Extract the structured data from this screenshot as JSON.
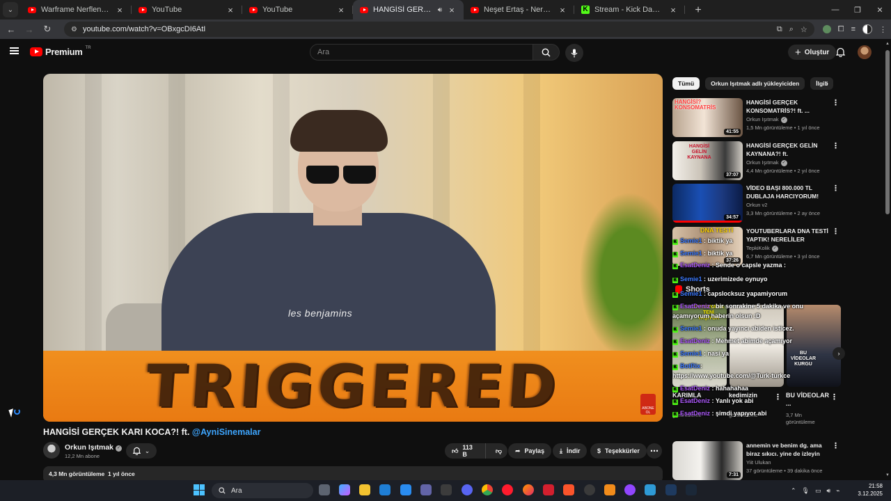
{
  "browser": {
    "tabs": [
      {
        "title": "Warframe Nerflenmeden Ö",
        "favicon": "youtube",
        "active": false
      },
      {
        "title": "YouTube",
        "favicon": "youtube",
        "active": false
      },
      {
        "title": "YouTube",
        "favicon": "youtube",
        "active": false
      },
      {
        "title": "HANGİSİ GERÇEK KARI KOC",
        "favicon": "youtube",
        "active": true,
        "audio": true
      },
      {
        "title": "Neşet Ertaş - Neredesin Sen (Je",
        "favicon": "youtube",
        "active": false
      },
      {
        "title": "Stream - Kick Dashboard",
        "favicon": "kick",
        "active": false
      }
    ],
    "url": "youtube.com/watch?v=OBxgcDI6AtI"
  },
  "header": {
    "logo_text": "Premium",
    "logo_region": "TR",
    "search_placeholder": "Ara",
    "create_label": "Oluştur"
  },
  "video": {
    "overlay_text": "TRIGGERED",
    "shirt_text": "les benjamins",
    "watermark": "ABONE OL",
    "title": "HANGİSİ GERÇEK KARI KOCA?! ft.",
    "title_link": "@AyniSinemalar",
    "channel": "Orkun Işıtmak",
    "subscribers": "12,2 Mn abone",
    "likes": "113 B",
    "share_label": "Paylaş",
    "download_label": "İndir",
    "thanks_label": "Teşekkürler",
    "views": "4,3 Mn görüntüleme",
    "age": "1 yıl önce"
  },
  "chips": [
    "Tümü",
    "Orkun Işıtmak adlı yükleyiciden",
    "İlgili"
  ],
  "recommendations": [
    {
      "title": "HANGİSİ GERÇEK KONSOMATRİS?! ft. ...",
      "channel": "Orkun Işıtmak",
      "verified": true,
      "meta": "1,5 Mn görüntüleme • 1 yıl önce",
      "duration": "41:55",
      "thumb_text": "HANGİSİ? KONSOMATRİS"
    },
    {
      "title": "HANGİSİ GERÇEK GELİN KAYNANA?! ft. @AyniSinemalar",
      "channel": "Orkun Işıtmak",
      "verified": true,
      "meta": "4,4 Mn görüntüleme • 2 yıl önce",
      "duration": "37:07",
      "thumb_text": "HANGİSİ GELİN KAYNANA"
    },
    {
      "title": "VİDEO BAŞI 800.000 TL DUBLAJA HARCIYORUM! Ruhi...",
      "channel": "Orkun v2",
      "verified": false,
      "meta": "3,3 Mn görüntüleme • 2 ay önce",
      "duration": "34:57",
      "thumb_text": ""
    },
    {
      "title": "YOUTUBERLARA DNA TESTİ YAPTIK! NERELİLER ÖĞRENDİK!",
      "channel": "TepkiKolik",
      "verified": true,
      "meta": "6,7 Mn görüntüleme • 3 yıl önce",
      "duration": "37:26",
      "thumb_text": "DNA TESTİ"
    }
  ],
  "shorts": {
    "heading": "Shorts",
    "items": [
      {
        "caption": "KARIMLA",
        "views": "görüntüleme"
      },
      {
        "caption": "kedimizin",
        "views": "görüntüleme"
      },
      {
        "caption": "BU VİDEOLAR ...",
        "views": "3,7 Mn görüntüleme"
      }
    ],
    "thumb_texts": [
      "JAPONYA'YA TENİ YAŞIYOR",
      "BU VİDEOLAR KURGU"
    ]
  },
  "last_rec": {
    "title": "annemin ve benim dg. ama biraz sıkıcı. yine de izleyin",
    "channel": "Yiit Ulukan",
    "meta": "37 görüntüleme • 39 dakika önce",
    "duration": "7:31"
  },
  "chat": [
    {
      "user": "Semie1",
      "msg": "biktik ya",
      "color": "blue"
    },
    {
      "user": "Semie1",
      "msg": "biktik ya",
      "color": "blue"
    },
    {
      "user": "EsatDeniz",
      "msg": "Sende o capsle yazma :",
      "color": "purple"
    },
    {
      "user": "Semie1",
      "msg": "uzerimizede oynuyo",
      "color": "blue"
    },
    {
      "user": "Semie1",
      "msg": "capslocksuz yapamiyorum",
      "color": "blue"
    },
    {
      "user": "EsatDeniz",
      "msg": "bir sonrakine 5 dakika ve onu",
      "color": "purple"
    },
    {
      "user": "",
      "msg": "açamıyorum haberin olsun :D",
      "color": "white"
    },
    {
      "user": "Semie1",
      "msg": "onuda yayıncı abiden isticez.",
      "color": "blue"
    },
    {
      "user": "EsatDeniz",
      "msg": "Mehmet abimde açamıyor",
      "color": "purple"
    },
    {
      "user": "Semie1",
      "msg": "nasi ya",
      "color": "blue"
    },
    {
      "user": "BotRix",
      "msg": "",
      "color": "blue"
    },
    {
      "user": "",
      "msg": "https://www.youtube.com/@Turk-turkce",
      "color": "white"
    },
    {
      "user": "EsatDeniz",
      "msg": "hahahahaa",
      "color": "purple"
    },
    {
      "user": "EsatDeniz",
      "msg": "Yanlı yok abi",
      "color": "purple"
    },
    {
      "user": "EsatDeniz",
      "msg": "şimdi yapıyor abi",
      "color": "purple"
    }
  ],
  "taskbar": {
    "search_label": "Ara",
    "time": "21:58",
    "date": "3.12.2025"
  },
  "colors": {
    "accent": "#ff0000",
    "link": "#3ea6ff",
    "kick": "#53fc18"
  }
}
